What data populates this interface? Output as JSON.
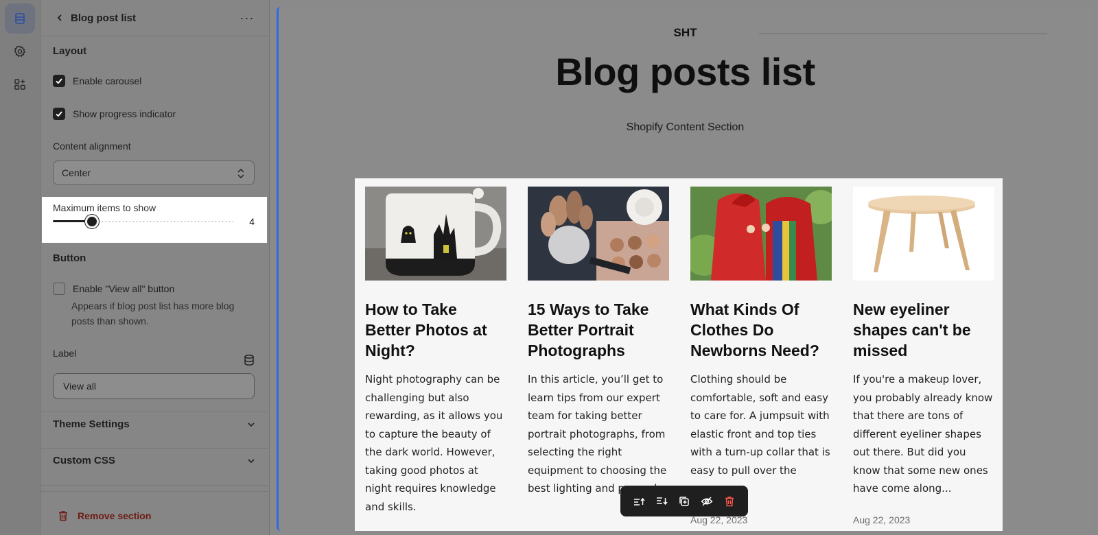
{
  "rail": {
    "icons": [
      "sections-icon",
      "settings-gear-icon",
      "add-apps-icon"
    ]
  },
  "panel": {
    "title": "Blog post list",
    "more_label": "···",
    "layout": {
      "title": "Layout",
      "enable_carousel": {
        "label": "Enable carousel",
        "checked": true
      },
      "show_progress": {
        "label": "Show progress indicator",
        "checked": true
      },
      "content_alignment": {
        "label": "Content alignment",
        "value": "Center"
      },
      "max_items": {
        "label": "Maximum items to show",
        "value": "4"
      }
    },
    "button": {
      "title": "Button",
      "enable_view_all": {
        "label": "Enable \"View all\" button",
        "checked": false
      },
      "help": "Appears if blog post list has more blog posts than shown.",
      "label_field": {
        "label": "Label",
        "value": "View all"
      }
    },
    "theme_settings": "Theme Settings",
    "custom_css": "Custom CSS",
    "remove_section": "Remove section"
  },
  "preview": {
    "brand": "SHT",
    "title": "Blog posts list",
    "subtitle": "Shopify Content Section",
    "cards": [
      {
        "title": "How to Take Better Photos at Night?",
        "excerpt": "Night photography can be challenging but also rewarding, as it allows you to capture the beauty of the dark world. However, taking good photos at night requires knowledge and skills.",
        "date": ""
      },
      {
        "title": "15 Ways to Take Better Portrait Photographs",
        "excerpt": "In this article, you’ll get to learn tips from our expert team for taking better portrait photographs, from selecting the right equipment to choosing the best lighting and p... and...",
        "date": ""
      },
      {
        "title": "What Kinds Of Clothes Do Newborns Need?",
        "excerpt": "Clothing should be comfortable, soft and easy to care for. A jumpsuit with elastic front and top ties with a turn-up collar that is easy to pull over the",
        "date": "Aug 22, 2023"
      },
      {
        "title": "New eyeliner shapes can't be missed",
        "excerpt": "If you're a makeup lover, you probably already know that there are tons of different eyeliner shapes out there. But did you know that some new ones have come along...",
        "date": "Aug 22, 2023"
      }
    ]
  },
  "toolbar": {
    "icons": [
      "move-up-icon",
      "move-down-icon",
      "duplicate-icon",
      "hide-icon",
      "delete-icon"
    ]
  }
}
